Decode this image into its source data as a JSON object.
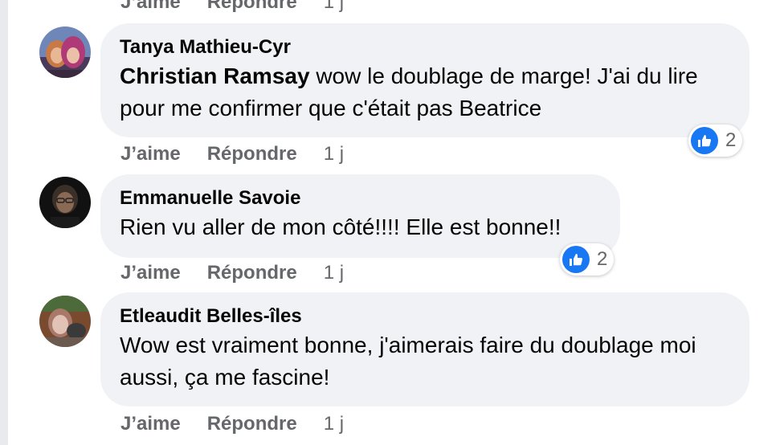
{
  "top_actions": {
    "like": "J’aime",
    "reply": "Répondre",
    "time": "1 j"
  },
  "comments": [
    {
      "author": "Tanya Mathieu-Cyr",
      "mention": "Christian Ramsay",
      "text": "wow le doublage de marge! J'ai du lire pour me confirmer que c'était pas Beatrice",
      "reaction_count": "2",
      "like": "J’aime",
      "reply": "Répondre",
      "time": "1 j"
    },
    {
      "author": "Emmanuelle Savoie",
      "text": "Rien vu aller de mon côté!!!! Elle est bonne!!",
      "reaction_count": "2",
      "like": "J’aime",
      "reply": "Répondre",
      "time": "1 j"
    },
    {
      "author": "Etleaudit Belles-îles",
      "text": "Wow est vraiment bonne, j'aimerais faire du doublage moi aussi, ça me fascine!",
      "like": "J’aime",
      "reply": "Répondre",
      "time": "1 j"
    }
  ],
  "colors": {
    "bubble": "#f0f2f5",
    "meta_text": "#65676b",
    "like_blue": "#1877f2"
  },
  "icons": {
    "reaction": "thumbs-up-icon"
  }
}
